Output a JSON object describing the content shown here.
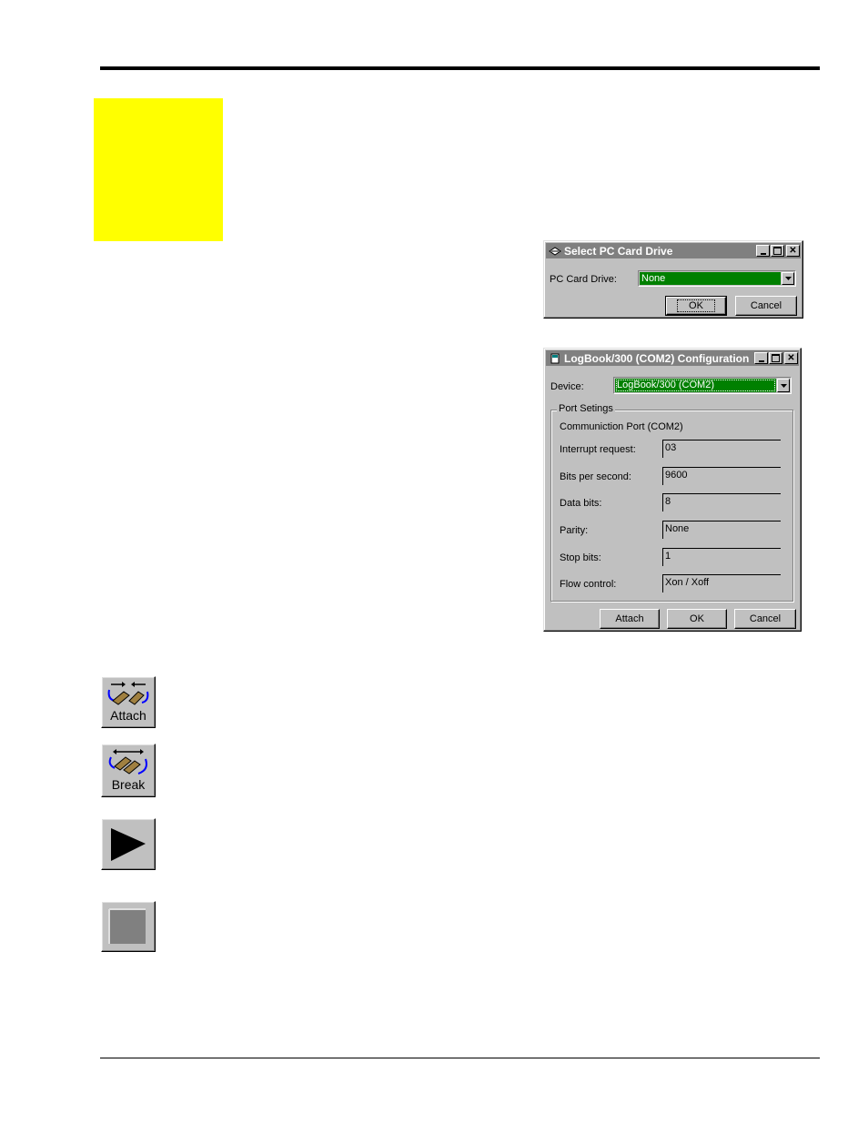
{
  "page": {
    "accent_yellow": "#ffff00"
  },
  "pc_card_dialog": {
    "title": "Select PC Card Drive",
    "title_icon": "drive-icon",
    "drive_label": "PC Card Drive:",
    "drive_value": "None",
    "drive_highlight": "#008000",
    "ok_label": "OK",
    "cancel_label": "Cancel"
  },
  "config_dialog": {
    "title": "LogBook/300 (COM2) Configuration",
    "title_icon": "book-icon",
    "device_label": "Device:",
    "device_value": "LogBook/300 (COM2)",
    "group_label": "Port Setings",
    "port_caption": "Communiction Port (COM2)",
    "fields": [
      {
        "label": "Interrupt request:",
        "value": "03"
      },
      {
        "label": "Bits per second:",
        "value": "9600"
      },
      {
        "label": "Data bits:",
        "value": "8"
      },
      {
        "label": "Parity:",
        "value": "None"
      },
      {
        "label": "Stop bits:",
        "value": "1"
      },
      {
        "label": "Flow control:",
        "value": "Xon / Xoff"
      }
    ],
    "attach_label": "Attach",
    "ok_label": "OK",
    "cancel_label": "Cancel"
  },
  "toolbar_buttons": [
    {
      "label": "Attach",
      "icon": "attach-icon"
    },
    {
      "label": "Break",
      "icon": "break-icon"
    },
    {
      "label": "",
      "icon": "play-icon"
    },
    {
      "label": "",
      "icon": "stop-icon"
    }
  ]
}
